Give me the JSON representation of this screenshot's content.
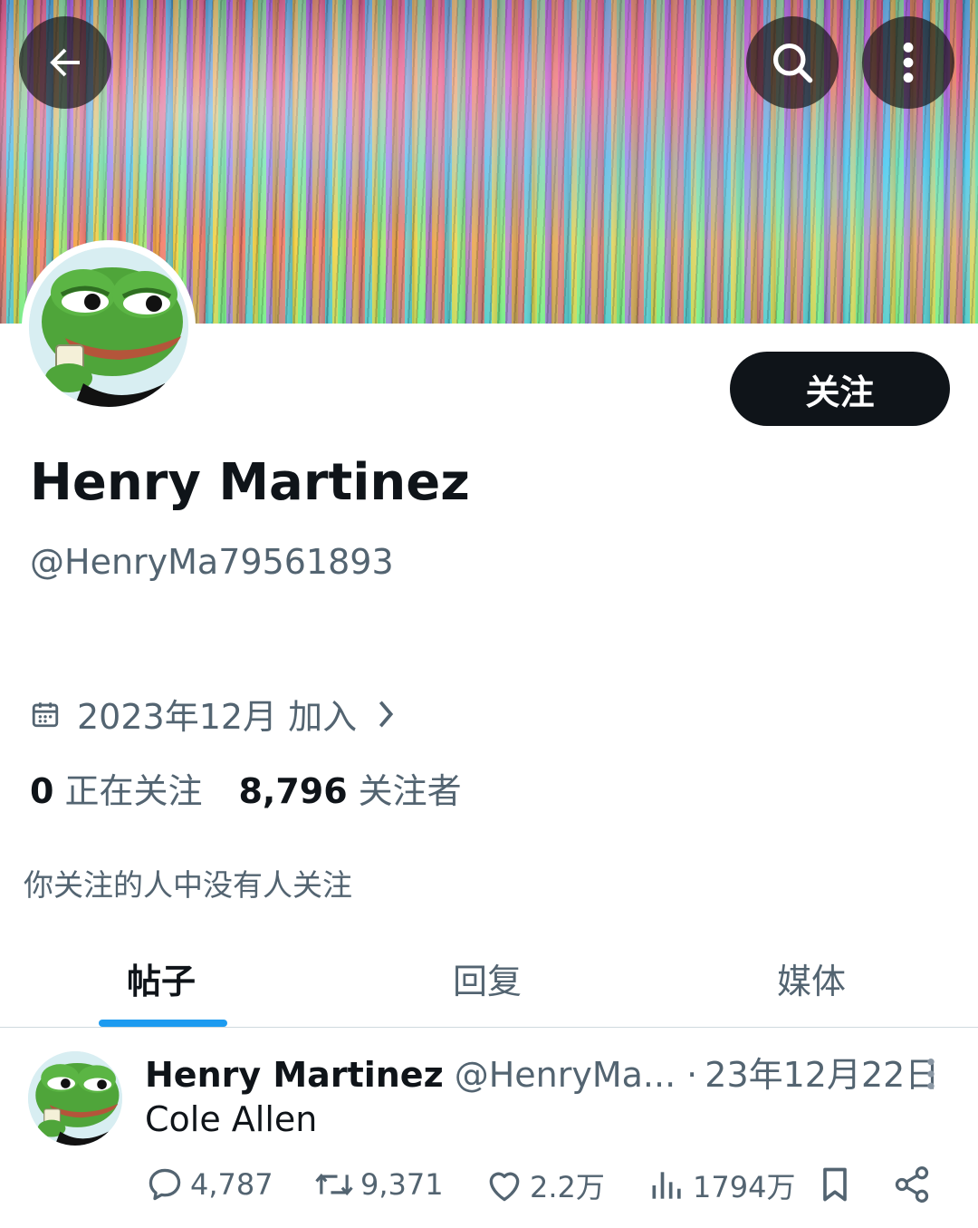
{
  "header": {
    "back_icon": "arrow-left-icon",
    "search_icon": "search-icon",
    "more_icon": "more-vertical-icon"
  },
  "profile": {
    "name": "Henry Martinez",
    "handle": "@HenryMa79561893",
    "follow_label": "关注",
    "join_text": "2023年12月 加入",
    "following_count": "0",
    "following_label": "正在关注",
    "followers_count": "8,796",
    "followers_label": "关注者",
    "mutual_text": "你关注的人中没有人关注"
  },
  "tabs": [
    {
      "label": "帖子",
      "active": true
    },
    {
      "label": "回复",
      "active": false
    },
    {
      "label": "媒体",
      "active": false
    }
  ],
  "post": {
    "name": "Henry Martinez",
    "handle": "@HenryMa...",
    "separator": "·",
    "date": "23年12月22日",
    "text": "Cole Allen",
    "replies": "4,787",
    "reposts": "9,371",
    "likes": "2.2万",
    "views": "1794万"
  },
  "colors": {
    "accent": "#1d9bf0",
    "text_primary": "#0f1419",
    "text_secondary": "#536471",
    "button_dark": "#0f1419"
  }
}
